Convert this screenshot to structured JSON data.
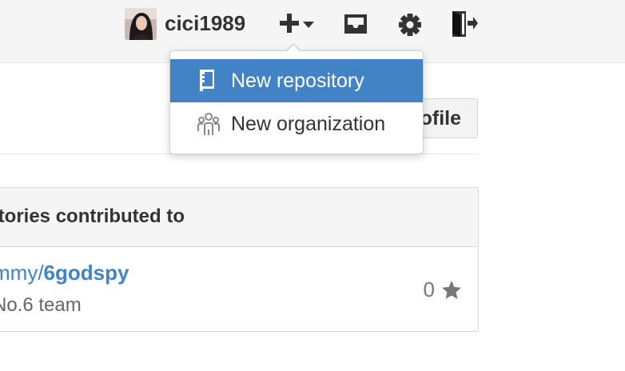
{
  "header": {
    "username": "cici1989",
    "icons": [
      "plus-icon",
      "chevron-down-icon",
      "inbox-icon",
      "gear-icon",
      "sign-out-icon"
    ]
  },
  "dropdown": {
    "items": [
      {
        "label": "New repository",
        "icon": "repo-icon",
        "active": true
      },
      {
        "label": "New organization",
        "icon": "organization-icon",
        "active": false
      }
    ]
  },
  "profile": {
    "edit_button_label": "ofile"
  },
  "contributions": {
    "title": "itories contributed to",
    "repo": {
      "owner_part": "mmy/",
      "name": "6godspy",
      "description": "No.6 team",
      "stars": "0"
    }
  },
  "colors": {
    "accent": "#4183c4",
    "header_bg": "#f5f5f5"
  }
}
